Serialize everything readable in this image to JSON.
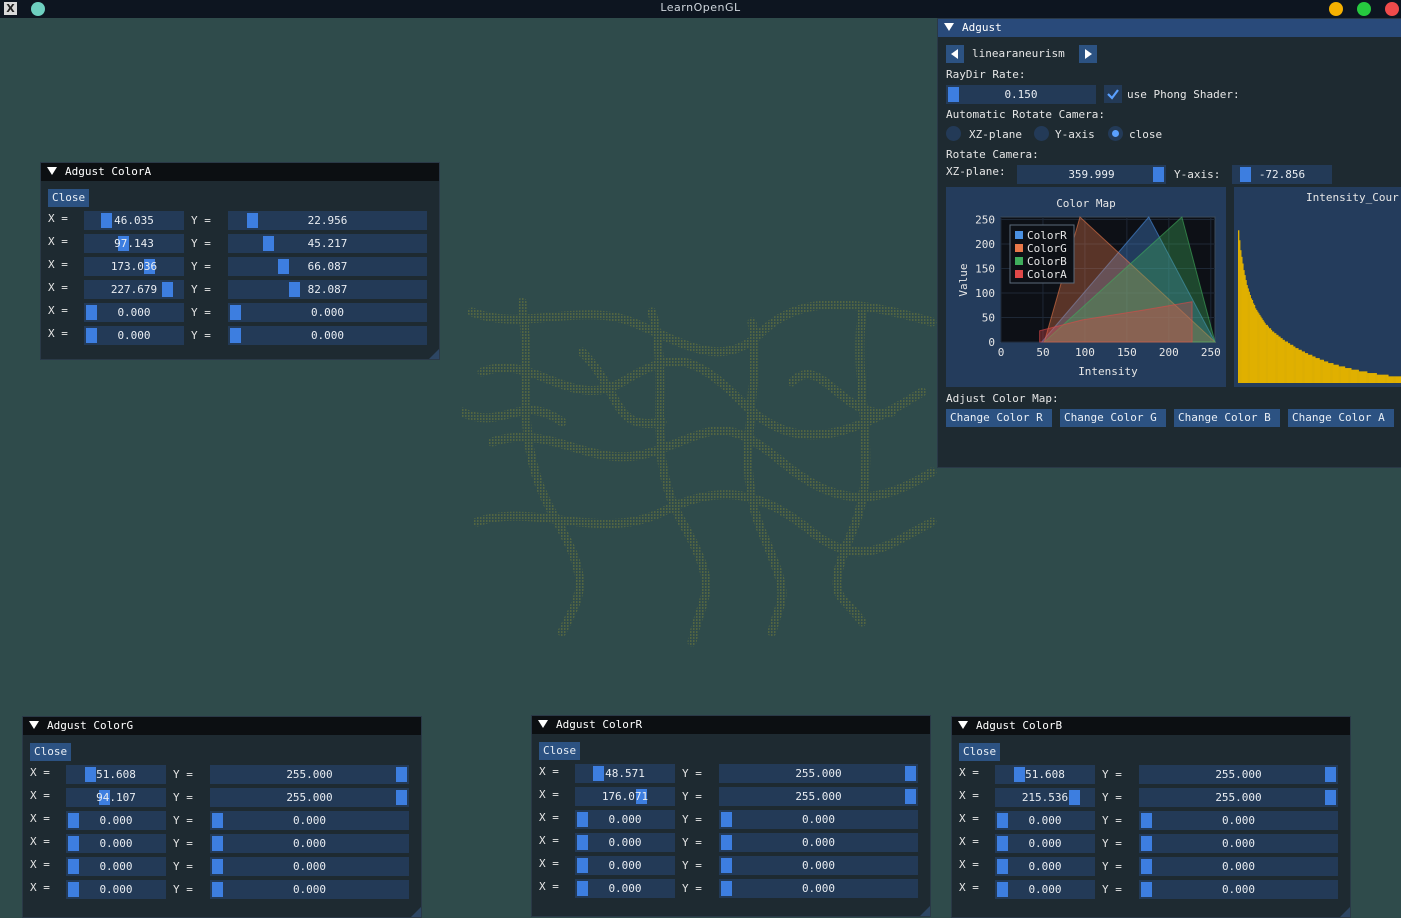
{
  "window": {
    "title": "LearnOpenGL",
    "buttons": {
      "minimize_color": "#f6b100",
      "maximize_color": "#26c93f",
      "close_color": "#f04b4b",
      "app_color": "#6ed0c0"
    }
  },
  "colors": {
    "bg": "#2f4b4b",
    "panel": "#1e2a31",
    "title_active": "#294a7a",
    "button": "#2c5282",
    "frame": "#233a57",
    "grab": "#3d7ee0"
  },
  "adjust_panel": {
    "title": "Adgust",
    "dataset": "linearaneurism",
    "raydir_label": "RayDir Rate:",
    "raydir_value": "0.150",
    "raydir_fraction": 0.0,
    "phong_label": "use Phong Shader:",
    "phong_checked": true,
    "auto_rotate_label": "Automatic Rotate Camera:",
    "radios": [
      {
        "label": "XZ-plane",
        "selected": false
      },
      {
        "label": "Y-axis",
        "selected": false
      },
      {
        "label": "close",
        "selected": true
      }
    ],
    "rotate_label": "Rotate Camera:",
    "xz_label": "XZ-plane:",
    "xz_value": "359.999",
    "y_axis_label": "Y-axis:",
    "y_axis_value": "-72.856",
    "adjust_color_map_label": "Adjust Color Map:",
    "color_buttons": [
      "Change Color R",
      "Change Color G",
      "Change Color B",
      "Change Color A"
    ]
  },
  "chart_data": [
    {
      "type": "area",
      "title": "Color Map",
      "xlabel": "Intensity",
      "ylabel": "Value",
      "xlim": [
        0,
        255
      ],
      "ylim": [
        0,
        255
      ],
      "x_ticks": [
        "0",
        "50",
        "100",
        "150",
        "200",
        "250"
      ],
      "y_ticks": [
        "0",
        "50",
        "100",
        "150",
        "200",
        "250"
      ],
      "legend_position": "top-left",
      "series": [
        {
          "name": "ColorR",
          "color": "#4a90e2",
          "points": [
            [
              48.571,
              0
            ],
            [
              176.071,
              255
            ],
            [
              255,
              0
            ]
          ]
        },
        {
          "name": "ColorG",
          "color": "#e8784a",
          "points": [
            [
              51.608,
              0
            ],
            [
              94.107,
              255
            ],
            [
              255,
              0
            ]
          ]
        },
        {
          "name": "ColorB",
          "color": "#3fae5c",
          "points": [
            [
              51.608,
              0
            ],
            [
              215.536,
              255
            ],
            [
              255,
              0
            ]
          ]
        },
        {
          "name": "ColorA",
          "color": "#e04848",
          "points": [
            [
              46.035,
              22.956
            ],
            [
              97.143,
              45.217
            ],
            [
              173.036,
              66.087
            ],
            [
              227.679,
              82.087
            ]
          ]
        }
      ]
    },
    {
      "type": "bar",
      "title": "Intensity_Cour",
      "color": "#e0b000",
      "values": [
        0.92,
        0.86,
        0.8,
        0.76,
        0.72,
        0.68,
        0.65,
        0.62,
        0.59,
        0.57,
        0.55,
        0.53,
        0.51,
        0.5,
        0.48,
        0.47,
        0.45,
        0.44,
        0.43,
        0.42,
        0.41,
        0.4,
        0.39,
        0.38,
        0.37,
        0.36,
        0.35,
        0.35,
        0.34,
        0.33,
        0.33,
        0.32,
        0.31,
        0.31,
        0.3,
        0.3,
        0.29,
        0.29,
        0.28,
        0.28,
        0.27,
        0.27,
        0.26,
        0.26,
        0.25,
        0.25,
        0.25,
        0.24,
        0.24,
        0.23,
        0.23,
        0.23,
        0.22,
        0.22,
        0.21,
        0.21,
        0.21,
        0.2,
        0.2,
        0.2,
        0.19,
        0.19,
        0.19,
        0.18,
        0.18,
        0.18,
        0.17,
        0.17,
        0.17,
        0.17,
        0.16,
        0.16,
        0.16,
        0.15,
        0.15,
        0.15,
        0.15,
        0.14,
        0.14,
        0.14,
        0.14,
        0.13,
        0.13,
        0.13,
        0.13,
        0.12,
        0.12,
        0.12,
        0.12,
        0.12,
        0.11,
        0.11,
        0.11,
        0.11,
        0.11,
        0.1,
        0.1,
        0.1,
        0.1,
        0.1,
        0.1,
        0.09,
        0.09,
        0.09,
        0.09,
        0.09,
        0.09,
        0.08,
        0.08,
        0.08,
        0.08,
        0.08,
        0.08,
        0.08,
        0.07,
        0.07,
        0.07,
        0.07,
        0.07,
        0.07,
        0.07,
        0.07,
        0.06,
        0.06,
        0.06,
        0.06,
        0.06,
        0.06,
        0.06,
        0.06,
        0.06,
        0.05,
        0.05,
        0.05,
        0.05,
        0.05,
        0.05,
        0.05,
        0.05,
        0.05,
        0.05,
        0.05,
        0.04,
        0.04,
        0.04,
        0.04,
        0.04,
        0.04,
        0.04,
        0.04,
        0.04,
        0.04,
        0.04,
        0.04,
        0.04
      ]
    }
  ],
  "color_panels": [
    {
      "id": "A",
      "title": "Adgust ColorA",
      "close": "Close",
      "rows": [
        {
          "x": "46.035",
          "xf": 0.18,
          "y": "22.956",
          "yf": 0.09
        },
        {
          "x": "97.143",
          "xf": 0.38,
          "y": "45.217",
          "yf": 0.18
        },
        {
          "x": "173.036",
          "xf": 0.68,
          "y": "66.087",
          "yf": 0.26
        },
        {
          "x": "227.679",
          "xf": 0.89,
          "y": "82.087",
          "yf": 0.32
        },
        {
          "x": "0.000",
          "xf": 0.0,
          "y": "0.000",
          "yf": 0.0
        },
        {
          "x": "0.000",
          "xf": 0.0,
          "y": "0.000",
          "yf": 0.0
        }
      ]
    },
    {
      "id": "G",
      "title": "Adgust ColorG",
      "close": "Close",
      "rows": [
        {
          "x": "51.608",
          "xf": 0.2,
          "y": "255.000",
          "yf": 1.0
        },
        {
          "x": "94.107",
          "xf": 0.37,
          "y": "255.000",
          "yf": 1.0
        },
        {
          "x": "0.000",
          "xf": 0.0,
          "y": "0.000",
          "yf": 0.0
        },
        {
          "x": "0.000",
          "xf": 0.0,
          "y": "0.000",
          "yf": 0.0
        },
        {
          "x": "0.000",
          "xf": 0.0,
          "y": "0.000",
          "yf": 0.0
        },
        {
          "x": "0.000",
          "xf": 0.0,
          "y": "0.000",
          "yf": 0.0
        }
      ]
    },
    {
      "id": "R",
      "title": "Adgust ColorR",
      "close": "Close",
      "rows": [
        {
          "x": "48.571",
          "xf": 0.19,
          "y": "255.000",
          "yf": 1.0
        },
        {
          "x": "176.071",
          "xf": 0.69,
          "y": "255.000",
          "yf": 1.0
        },
        {
          "x": "0.000",
          "xf": 0.0,
          "y": "0.000",
          "yf": 0.0
        },
        {
          "x": "0.000",
          "xf": 0.0,
          "y": "0.000",
          "yf": 0.0
        },
        {
          "x": "0.000",
          "xf": 0.0,
          "y": "0.000",
          "yf": 0.0
        },
        {
          "x": "0.000",
          "xf": 0.0,
          "y": "0.000",
          "yf": 0.0
        }
      ]
    },
    {
      "id": "B",
      "title": "Adgust ColorB",
      "close": "Close",
      "rows": [
        {
          "x": "51.608",
          "xf": 0.2,
          "y": "255.000",
          "yf": 1.0
        },
        {
          "x": "215.536",
          "xf": 0.85,
          "y": "255.000",
          "yf": 1.0
        },
        {
          "x": "0.000",
          "xf": 0.0,
          "y": "0.000",
          "yf": 0.0
        },
        {
          "x": "0.000",
          "xf": 0.0,
          "y": "0.000",
          "yf": 0.0
        },
        {
          "x": "0.000",
          "xf": 0.0,
          "y": "0.000",
          "yf": 0.0
        },
        {
          "x": "0.000",
          "xf": 0.0,
          "y": "0.000",
          "yf": 0.0
        }
      ]
    }
  ],
  "row_labels": {
    "x": "X =",
    "y": "Y ="
  }
}
